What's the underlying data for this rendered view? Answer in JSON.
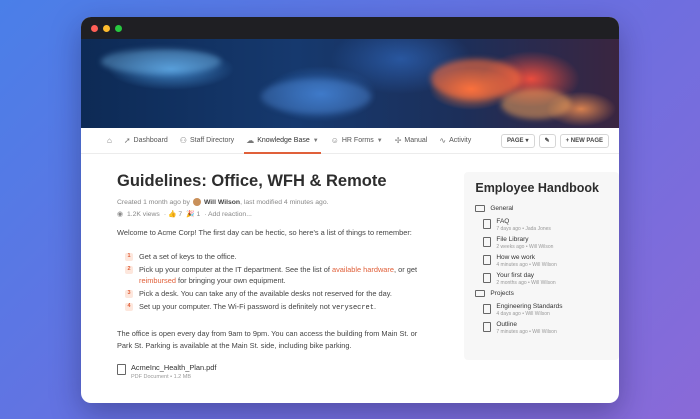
{
  "nav": {
    "items": [
      {
        "label": "Dashboard",
        "icon": "rocket-icon"
      },
      {
        "label": "Staff Directory",
        "icon": "people-icon"
      },
      {
        "label": "Knowledge Base",
        "icon": "brain-icon"
      },
      {
        "label": "HR Forms",
        "icon": "person-icon"
      },
      {
        "label": "Manual",
        "icon": "book-icon"
      },
      {
        "label": "Activity",
        "icon": "pulse-icon"
      }
    ],
    "page_button": "PAGE",
    "new_page_button": "+ NEW PAGE"
  },
  "page": {
    "title": "Guidelines: Office, WFH & Remote",
    "created": "Created 1 month ago by",
    "author": "Will Wilson",
    "modified": ", last modified 4 minutes ago.",
    "views": "1.2K views",
    "thumbs": "7",
    "party": "1",
    "add_reaction": "· Add reaction...",
    "intro": "Welcome to Acme Corp! The first day can be hectic, so here's a list of things to remember:",
    "steps": [
      {
        "num": "1",
        "text": "Get a set of keys to the office."
      },
      {
        "num": "2",
        "pre": "Pick up your computer at the IT department. See the list of ",
        "link1": "available hardware",
        "mid": ", or get ",
        "link2": "reimbursed",
        "post": " for bringing your own equipment."
      },
      {
        "num": "3",
        "text": "Pick a desk. You can take any of the available desks not reserved for the day."
      },
      {
        "num": "4",
        "pre": "Set up your computer. The Wi-Fi password is definitely not ",
        "code": "verysecret",
        "post": "."
      }
    ],
    "paragraph": "The office is open every day from 9am to 9pm. You can access the building from Main St. or Park St. Parking is available at the Main St. side, including bike parking.",
    "file": {
      "name": "AcmeInc_Health_Plan.pdf",
      "meta": "PDF Document • 1.2 MB"
    }
  },
  "sidebar": {
    "title": "Employee Handbook",
    "folders": [
      {
        "name": "General",
        "docs": [
          {
            "name": "FAQ",
            "meta": "7 days ago • Jada Jones"
          },
          {
            "name": "File Library",
            "meta": "2 weeks ago • Will Wilson"
          },
          {
            "name": "How we work",
            "meta": "4 minutes ago • Will Wilson"
          },
          {
            "name": "Your first day",
            "meta": "2 months ago • Will Wilson"
          }
        ]
      },
      {
        "name": "Projects",
        "docs": [
          {
            "name": "Engineering Standards",
            "meta": "4 days ago • Will Wilson"
          },
          {
            "name": "Outline",
            "meta": "7 minutes ago • Will Wilson"
          }
        ]
      }
    ]
  }
}
